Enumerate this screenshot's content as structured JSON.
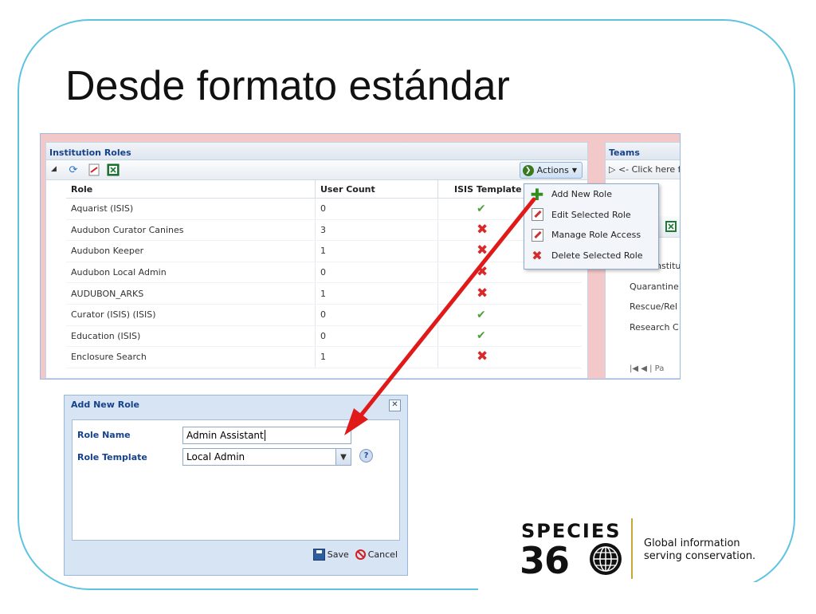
{
  "slide": {
    "title": "Desde formato estándar"
  },
  "roles_panel": {
    "title": "Institution Roles",
    "actions_label": "Actions",
    "columns": [
      "Role",
      "User Count",
      "ISIS Template"
    ],
    "rows": [
      {
        "role": "Aquarist (ISIS)",
        "count": "0",
        "isis": true
      },
      {
        "role": "Audubon Curator Canines",
        "count": "3",
        "isis": false
      },
      {
        "role": "Audubon Keeper",
        "count": "1",
        "isis": false
      },
      {
        "role": "Audubon Local Admin",
        "count": "0",
        "isis": false
      },
      {
        "role": "AUDUBON_ARKS",
        "count": "1",
        "isis": false
      },
      {
        "role": "Curator (ISIS) (ISIS)",
        "count": "0",
        "isis": true
      },
      {
        "role": "Education (ISIS)",
        "count": "0",
        "isis": true
      },
      {
        "role": "Enclosure Search",
        "count": "1",
        "isis": false
      }
    ]
  },
  "actions_menu": {
    "items": [
      {
        "label": "Add New Role",
        "icon": "plus-icon"
      },
      {
        "label": "Edit Selected Role",
        "icon": "edit-icon"
      },
      {
        "label": "Manage Role Access",
        "icon": "edit-icon"
      },
      {
        "label": "Delete Selected Role",
        "icon": "delete-icon"
      }
    ]
  },
  "teams_panel": {
    "title": "Teams",
    "hint": "<- Click here f",
    "items": [
      "Main Institu",
      "Quarantine",
      "Rescue/Rel",
      "Research C"
    ],
    "pager": "Pa"
  },
  "dialog": {
    "title": "Add New Role",
    "role_name_label": "Role Name",
    "role_name_value": "Admin Assistant",
    "role_template_label": "Role Template",
    "role_template_value": "Local Admin",
    "save_label": "Save",
    "cancel_label": "Cancel",
    "close_glyph": "✕",
    "help_glyph": "?"
  },
  "logo": {
    "line1": "SPECIES",
    "line2": "36",
    "tagline1": "Global information",
    "tagline2": "serving conservation."
  },
  "colors": {
    "frame": "#5ec3e0",
    "arrow": "#e01919",
    "header_text": "#15428b"
  }
}
